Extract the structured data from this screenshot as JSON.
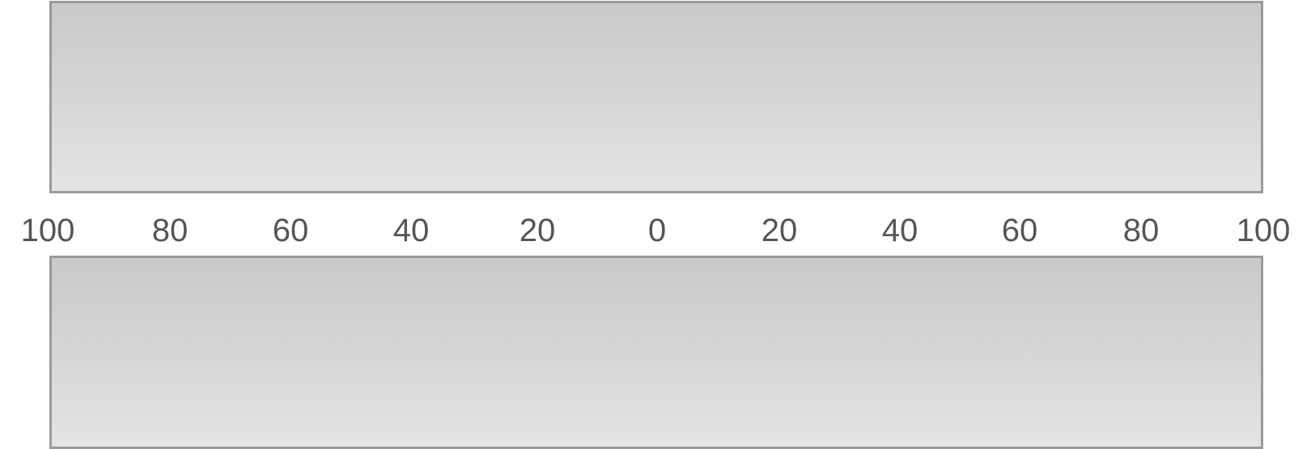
{
  "scale": {
    "ticks": [
      "100",
      "80",
      "60",
      "40",
      "20",
      "0",
      "20",
      "40",
      "60",
      "80",
      "100"
    ]
  },
  "colors": {
    "panel_border": "#9a9a9a",
    "panel_gradient_top": "#c9c9c9",
    "panel_gradient_bottom": "#e4e4e4",
    "tick_text": "#555555"
  }
}
